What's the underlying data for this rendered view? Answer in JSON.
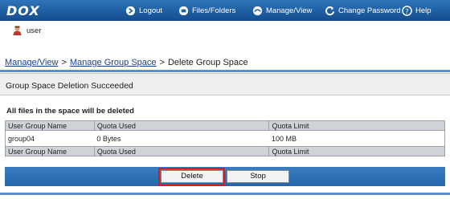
{
  "header": {
    "logo": "DOX",
    "nav": [
      {
        "label": "Logout",
        "icon": "logout-icon"
      },
      {
        "label": "Files/Folders",
        "icon": "folder-icon"
      },
      {
        "label": "Manage/View",
        "icon": "manage-icon"
      },
      {
        "label": "Change Password",
        "icon": "refresh-icon"
      },
      {
        "label": "Help",
        "icon": "help-icon"
      }
    ]
  },
  "user": {
    "name": "user",
    "icon": "user-icon"
  },
  "breadcrumb": {
    "items": [
      "Manage/View",
      "Manage Group Space",
      "Delete Group Space"
    ],
    "separator": ">"
  },
  "section": {
    "title": "Group Space Deletion Succeeded"
  },
  "warning": "All files in the space will be deleted",
  "table": {
    "headers": [
      "User Group Name",
      "Quota Used",
      "Quota Limit"
    ],
    "rows": [
      [
        "group04",
        "0 Bytes",
        "100 MB"
      ]
    ]
  },
  "buttons": {
    "delete": "Delete",
    "stop": "Stop"
  },
  "colors": {
    "header": "#1f5fa3",
    "highlight": "#e01a1a",
    "link": "#1a3f8f"
  }
}
